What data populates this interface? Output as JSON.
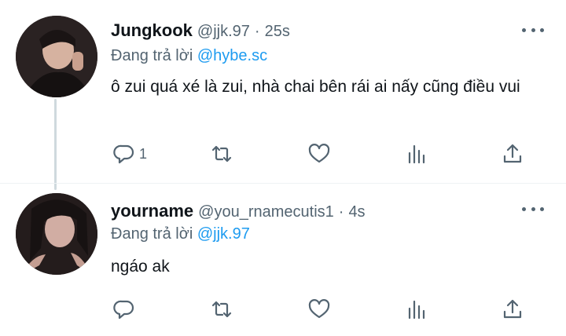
{
  "tweets": [
    {
      "name": "Jungkook",
      "handle": "@jjk.97",
      "time": "25s",
      "reply_prefix": "Đang trả lời",
      "reply_to": "@hybe.sc",
      "text": "ô zui quá xé là zui, nhà chai bên rái ai nấy cũng điều vui",
      "reply_count": "1"
    },
    {
      "name": "yourname",
      "handle": "@you_rnamecutis1",
      "time": "4s",
      "reply_prefix": "Đang trả lời",
      "reply_to": "@jjk.97",
      "text": "ngáo ak",
      "reply_count": ""
    }
  ],
  "separator": "·",
  "icons": [
    "reply-icon",
    "retweet-icon",
    "like-icon",
    "stats-icon",
    "share-icon",
    "more-icon"
  ],
  "colors": {
    "text": "#0f1419",
    "secondary": "#536471",
    "link": "#1d9bf0",
    "thread_line": "#cfd9de"
  }
}
